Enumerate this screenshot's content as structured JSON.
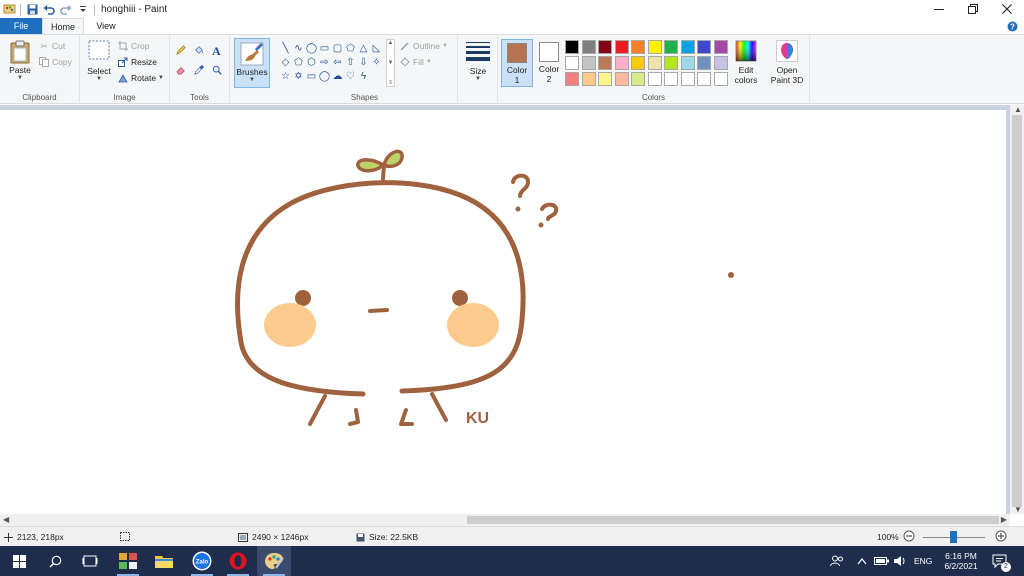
{
  "window": {
    "title": "honghiii - Paint"
  },
  "tabs": {
    "file": "File",
    "home": "Home",
    "view": "View"
  },
  "ribbon": {
    "clipboard": {
      "label": "Clipboard",
      "paste": "Paste",
      "cut": "Cut",
      "copy": "Copy"
    },
    "image": {
      "label": "Image",
      "select": "Select",
      "crop": "Crop",
      "resize": "Resize",
      "rotate": "Rotate"
    },
    "tools": {
      "label": "Tools"
    },
    "brushes": {
      "label": "Brushes"
    },
    "shapes": {
      "label": "Shapes",
      "outline": "Outline",
      "fill": "Fill"
    },
    "size": {
      "label": "Size"
    },
    "colors": {
      "label": "Colors",
      "color1_label": "Color",
      "color1_num": "1",
      "color2_label": "Color",
      "color2_num": "2",
      "color1_value": "#b5734f",
      "color2_value": "#ffffff",
      "edit_colors_1": "Edit",
      "edit_colors_2": "colors",
      "open_paint3d_1": "Open",
      "open_paint3d_2": "Paint 3D",
      "palette": [
        "#000000",
        "#7f7f7f",
        "#880015",
        "#ed1c24",
        "#ff7f27",
        "#fff200",
        "#22b14c",
        "#00a2e8",
        "#3f48cc",
        "#a349a4",
        "#ffffff",
        "#c3c3c3",
        "#b97a57",
        "#ffaec9",
        "#ffc90e",
        "#efe4b0",
        "#b5e61d",
        "#99d9ea",
        "#7092be",
        "#c8bfe7",
        "#f47e7e",
        "#fdc88a",
        "#fff58a",
        "#fcb9a0",
        "#d8ec8a",
        "#ffffff",
        "#ffffff",
        "#ffffff",
        "#ffffff",
        "#ffffff"
      ]
    }
  },
  "canvas": {
    "drawing_text": "KU",
    "stroke_color": "#a0623e",
    "cheek_color": "#fdcb8e",
    "sprout_color": "#bcd36b"
  },
  "status": {
    "cursor_pos": "2123, 218px",
    "image_dims": "2490 × 1246px",
    "file_size": "Size: 22.5KB",
    "zoom": "100%"
  },
  "taskbar": {
    "language": "ENG",
    "time": "6:16 PM",
    "date": "6/2/2021",
    "notifications": "2",
    "zalo_label": "Zalo"
  }
}
